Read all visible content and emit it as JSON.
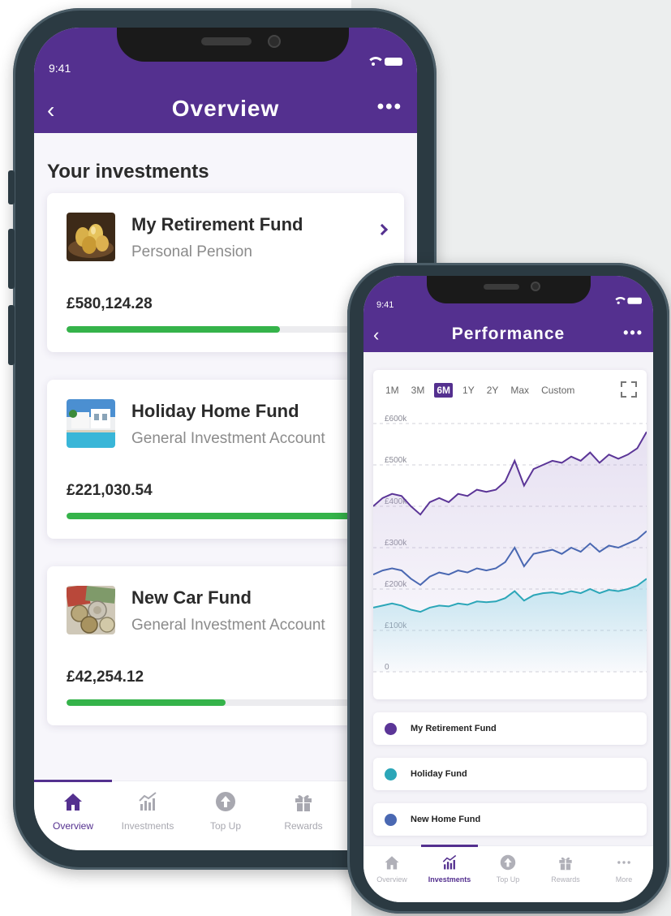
{
  "colors": {
    "brand_purple": "#54308f",
    "progress_green": "#35b34a",
    "retirement_series": "#5b3597",
    "home_series": "#4a68b2",
    "holiday_series": "#2ba6b8"
  },
  "phone1": {
    "status": {
      "time": "9:41"
    },
    "header": {
      "title": "Overview"
    },
    "section_title": "Your investments",
    "cards": [
      {
        "name": "My Retirement Fund",
        "type": "Personal Pension",
        "value": "£580,124.28",
        "progress": 0.67,
        "thumb": "golden-eggs-image"
      },
      {
        "name": "Holiday Home Fund",
        "type": "General Investment Account",
        "value": "£221,030.54",
        "progress": 0.9,
        "thumb": "villa-pool-image"
      },
      {
        "name": "New Car Fund",
        "type": "General Investment Account",
        "value": "£42,254.12",
        "progress": 0.5,
        "thumb": "coins-notes-image"
      }
    ],
    "tabs": [
      {
        "label": "Overview",
        "icon": "home-icon",
        "active": true
      },
      {
        "label": "Investments",
        "icon": "investments-chart-icon",
        "active": false
      },
      {
        "label": "Top Up",
        "icon": "arrow-up-circle-icon",
        "active": false
      },
      {
        "label": "Rewards",
        "icon": "gift-icon",
        "active": false
      }
    ]
  },
  "phone2": {
    "status": {
      "time": "9:41"
    },
    "header": {
      "title": "Performance"
    },
    "ranges": [
      "1M",
      "3M",
      "6M",
      "1Y",
      "2Y",
      "Max",
      "Custom"
    ],
    "active_range": "6M",
    "legend": [
      {
        "label": "My Retirement Fund",
        "color": "#5b3597"
      },
      {
        "label": "Holiday Fund",
        "color": "#2ba6b8"
      },
      {
        "label": "New Home Fund",
        "color": "#4a68b2"
      }
    ],
    "tabs": [
      {
        "label": "Overview",
        "icon": "home-icon",
        "active": false
      },
      {
        "label": "Investments",
        "icon": "investments-chart-icon",
        "active": true
      },
      {
        "label": "Top Up",
        "icon": "arrow-up-circle-icon",
        "active": false
      },
      {
        "label": "Rewards",
        "icon": "gift-icon",
        "active": false
      },
      {
        "label": "More",
        "icon": "more-dots-icon",
        "active": false
      }
    ]
  },
  "chart_data": {
    "type": "line",
    "title": "",
    "xlabel": "",
    "ylabel": "",
    "ylim": [
      0,
      600000
    ],
    "yticks": [
      "0",
      "£100k",
      "£200k",
      "£300k",
      "£400k",
      "£500k",
      "£600k"
    ],
    "grid": true,
    "series": [
      {
        "name": "My Retirement Fund",
        "values": [
          400000,
          420000,
          430000,
          425000,
          400000,
          380000,
          410000,
          420000,
          410000,
          430000,
          425000,
          440000,
          435000,
          440000,
          460000,
          510000,
          450000,
          490000,
          500000,
          510000,
          505000,
          520000,
          510000,
          530000,
          505000,
          525000,
          515000,
          525000,
          540000,
          580000
        ]
      },
      {
        "name": "New Home Fund",
        "values": [
          235000,
          245000,
          250000,
          245000,
          225000,
          210000,
          230000,
          240000,
          235000,
          245000,
          240000,
          250000,
          245000,
          250000,
          265000,
          300000,
          255000,
          285000,
          290000,
          295000,
          285000,
          300000,
          290000,
          310000,
          290000,
          305000,
          300000,
          310000,
          320000,
          340000
        ]
      },
      {
        "name": "Holiday Fund",
        "values": [
          155000,
          160000,
          165000,
          160000,
          150000,
          145000,
          155000,
          160000,
          158000,
          165000,
          162000,
          170000,
          168000,
          170000,
          178000,
          195000,
          172000,
          185000,
          190000,
          192000,
          188000,
          195000,
          190000,
          200000,
          190000,
          198000,
          195000,
          200000,
          208000,
          225000
        ]
      }
    ]
  }
}
